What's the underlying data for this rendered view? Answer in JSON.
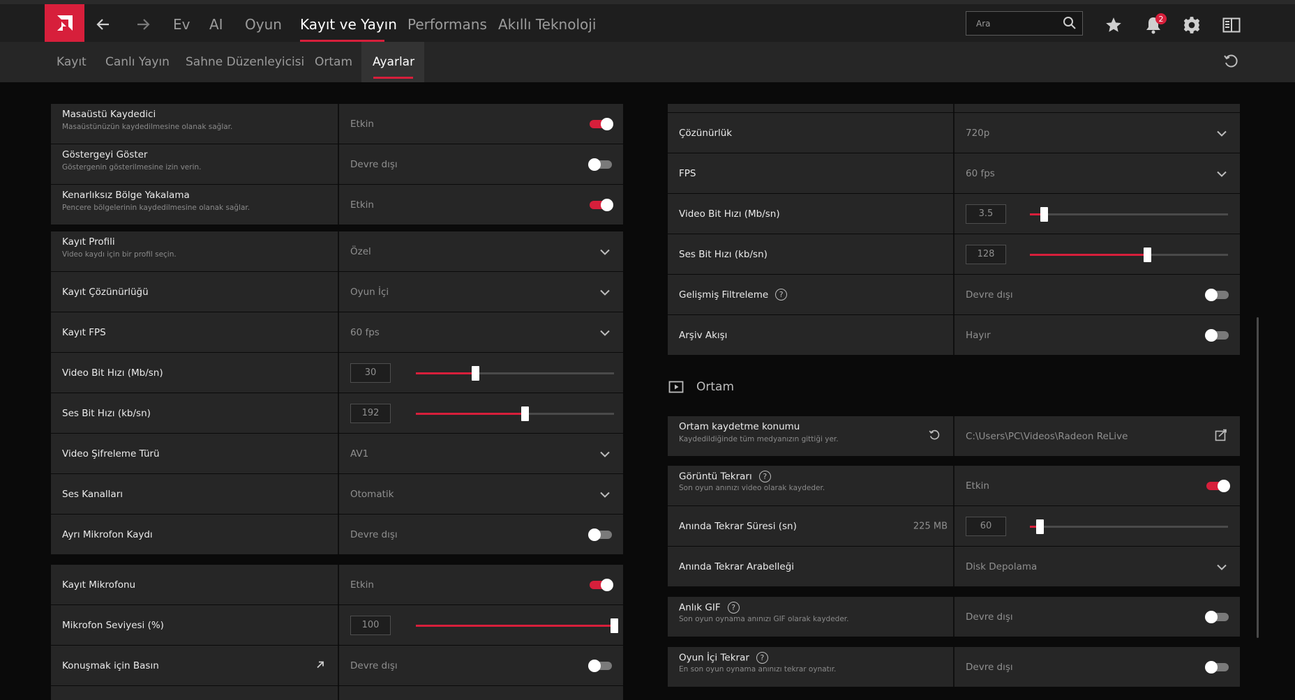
{
  "topbar": {
    "nav": [
      "Ev",
      "AI",
      "Oyun",
      "Kayıt ve Yayın",
      "Performans",
      "Akıllı Teknoloji"
    ],
    "active_nav": "Kayıt ve Yayın",
    "search_placeholder": "Ara",
    "notification_count": "2"
  },
  "subnav": {
    "items": [
      "Kayıt",
      "Canlı Yayın",
      "Sahne Düzenleyicisi",
      "Ortam",
      "Ayarlar"
    ],
    "active": "Ayarlar"
  },
  "left": {
    "desktop_recorder": {
      "title": "Masaüstü Kaydedici",
      "desc": "Masaüstünüzün kaydedilmesine olanak sağlar.",
      "value": "Etkin",
      "on": true
    },
    "show_indicator": {
      "title": "Göstergeyi Göster",
      "desc": "Göstergenin gösterilmesine izin verin.",
      "value": "Devre dışı",
      "on": false
    },
    "borderless_capture": {
      "title": "Kenarlıksız Bölge Yakalama",
      "desc": "Pencere bölgelerinin kaydedilmesine olanak sağlar.",
      "value": "Etkin",
      "on": true
    },
    "profile": {
      "title": "Kayıt Profili",
      "desc": "Video kaydı için bir profil seçin.",
      "value": "Özel"
    },
    "resolution": {
      "title": "Kayıt Çözünürlüğü",
      "value": "Oyun İçi"
    },
    "fps": {
      "title": "Kayıt FPS",
      "value": "60 fps"
    },
    "video_bitrate": {
      "title": "Video Bit Hızı (Mb/sn)",
      "value": "30",
      "level": 0.3
    },
    "audio_bitrate": {
      "title": "Ses Bit Hızı (kb/sn)",
      "value": "192",
      "level": 0.55
    },
    "encoding": {
      "title": "Video Şifreleme Türü",
      "value": "AV1"
    },
    "audio_channels": {
      "title": "Ses Kanalları",
      "value": "Otomatik"
    },
    "separate_mic": {
      "title": "Ayrı Mikrofon Kaydı",
      "value": "Devre dışı",
      "on": false
    },
    "record_mic": {
      "title": "Kayıt Mikrofonu",
      "value": "Etkin",
      "on": true
    },
    "mic_level": {
      "title": "Mikrofon Seviyesi (%)",
      "value": "100",
      "level": 1.0
    },
    "push_to_talk": {
      "title": "Konuşmak için Basın",
      "value": "Devre dışı",
      "on": false
    }
  },
  "right": {
    "resolution": {
      "title": "Çözünürlük",
      "value": "720p"
    },
    "fps": {
      "title": "FPS",
      "value": "60 fps"
    },
    "video_bitrate": {
      "title": "Video Bit Hızı (Mb/sn)",
      "value": "3.5",
      "level": 0.07
    },
    "audio_bitrate": {
      "title": "Ses Bit Hızı (kb/sn)",
      "value": "128",
      "level": 0.59
    },
    "advanced_filter": {
      "title": "Gelişmiş Filtreleme",
      "value": "Devre dışı",
      "on": false
    },
    "archive_stream": {
      "title": "Arşiv Akışı",
      "value": "Hayır",
      "on": false
    },
    "media_section": "Ortam",
    "media_location": {
      "title": "Ortam kaydetme konumu",
      "desc": "Kaydedildiğinde tüm medyanızın gittiği yer.",
      "value": "C:\\Users\\PC\\Videos\\Radeon ReLive"
    },
    "instant_replay": {
      "title": "Görüntü Tekrarı",
      "desc": "Son oyun anınızı video olarak kaydeder.",
      "value": "Etkin",
      "on": true
    },
    "replay_duration": {
      "title": "Anında Tekrar Süresi (sn)",
      "size": "225 MB",
      "value": "60",
      "level": 0.05
    },
    "replay_buffer": {
      "title": "Anında Tekrar Arabelleği",
      "value": "Disk Depolama"
    },
    "instant_gif": {
      "title": "Anlık GIF",
      "desc": "Son oyun oynama anınızı GIF olarak kaydeder.",
      "value": "Devre dışı",
      "on": false
    },
    "ingame_replay": {
      "title": "Oyun İçi Tekrar",
      "desc": "En son oyun oynama anınızı tekrar oynatır.",
      "value": "Devre dışı",
      "on": false
    }
  },
  "colors": {
    "accent": "#d71f3b",
    "panel": "#262626",
    "background": "#0a0a0a"
  }
}
